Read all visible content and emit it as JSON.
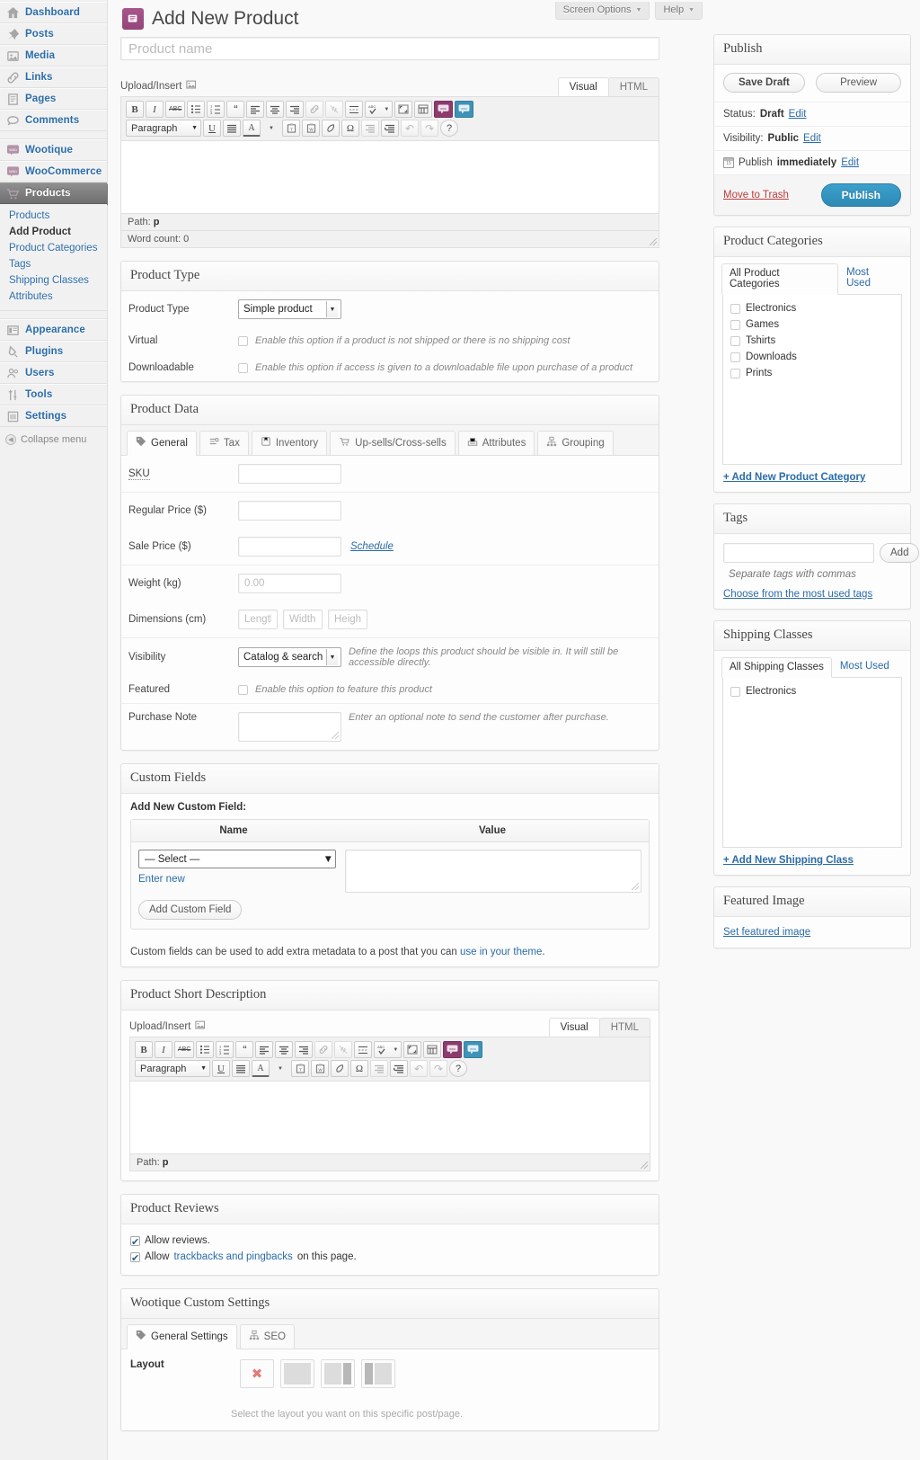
{
  "colors": {
    "accent_blue": "#2b6ca8",
    "publish_button": "#2d8ab5",
    "woo_purple": "#93467a",
    "trash_red": "#bc3c3c"
  },
  "sidebar": {
    "items": [
      {
        "label": "Dashboard",
        "icon": "dashboard-icon"
      },
      {
        "label": "Posts",
        "icon": "pin-icon"
      },
      {
        "label": "Media",
        "icon": "media-icon"
      },
      {
        "label": "Links",
        "icon": "link-icon"
      },
      {
        "label": "Pages",
        "icon": "pages-icon"
      },
      {
        "label": "Comments",
        "icon": "comment-icon"
      },
      {
        "label": "Wootique",
        "icon": "woo-icon"
      },
      {
        "label": "WooCommerce",
        "icon": "woo-icon"
      },
      {
        "label": "Products",
        "icon": "cart-icon"
      }
    ],
    "submenu": [
      {
        "label": "Products",
        "active": false
      },
      {
        "label": "Add Product",
        "active": true
      },
      {
        "label": "Product Categories",
        "active": false
      },
      {
        "label": "Tags",
        "active": false
      },
      {
        "label": "Shipping Classes",
        "active": false
      },
      {
        "label": "Attributes",
        "active": false
      }
    ],
    "items_bottom": [
      {
        "label": "Appearance",
        "icon": "appearance-icon"
      },
      {
        "label": "Plugins",
        "icon": "plugin-icon"
      },
      {
        "label": "Users",
        "icon": "users-icon"
      },
      {
        "label": "Tools",
        "icon": "tools-icon"
      },
      {
        "label": "Settings",
        "icon": "settings-icon"
      }
    ],
    "collapse_label": "Collapse menu"
  },
  "header": {
    "screen_options": "Screen Options",
    "help": "Help",
    "page_title": "Add New Product"
  },
  "title_field": {
    "placeholder": "Product name",
    "value": ""
  },
  "editor": {
    "upload_insert": "Upload/Insert",
    "tabs": [
      "Visual",
      "HTML"
    ],
    "active_tab": "Visual",
    "paragraph_select": "Paragraph",
    "path_label": "Path:",
    "path_value": "p",
    "word_count": "Word count: 0",
    "toolbar_row1": [
      {
        "glyph": "B",
        "name": "bold-icon"
      },
      {
        "glyph": "I",
        "name": "italic-icon"
      },
      {
        "glyph": "ABC",
        "name": "strikethrough-icon"
      },
      {
        "glyph": "",
        "name": "unordered-list-icon"
      },
      {
        "glyph": "",
        "name": "ordered-list-icon"
      },
      {
        "glyph": "“",
        "name": "blockquote-icon"
      },
      {
        "glyph": "",
        "name": "align-left-icon"
      },
      {
        "glyph": "",
        "name": "align-center-icon"
      },
      {
        "glyph": "",
        "name": "align-right-icon"
      },
      {
        "glyph": "",
        "name": "insert-link-icon"
      },
      {
        "glyph": "",
        "name": "unlink-icon"
      },
      {
        "glyph": "",
        "name": "more-tag-icon"
      },
      {
        "glyph": "ABC",
        "name": "spellcheck-icon"
      },
      {
        "glyph": "",
        "name": "fullscreen-icon"
      },
      {
        "glyph": "",
        "name": "kitchen-sink-icon"
      },
      {
        "glyph": "woo",
        "name": "woo-shortcode-icon"
      },
      {
        "glyph": "woo",
        "name": "woo-shortcode-alt-icon"
      }
    ],
    "toolbar_row2": [
      {
        "glyph": "U",
        "name": "underline-icon"
      },
      {
        "glyph": "",
        "name": "align-justify-icon"
      },
      {
        "glyph": "A",
        "name": "text-color-icon"
      },
      {
        "glyph": "",
        "name": "paste-text-icon"
      },
      {
        "glyph": "",
        "name": "paste-word-icon"
      },
      {
        "glyph": "",
        "name": "remove-formatting-icon"
      },
      {
        "glyph": "Ω",
        "name": "special-character-icon"
      },
      {
        "glyph": "",
        "name": "outdent-icon"
      },
      {
        "glyph": "",
        "name": "indent-icon"
      },
      {
        "glyph": "",
        "name": "undo-icon"
      },
      {
        "glyph": "",
        "name": "redo-icon"
      },
      {
        "glyph": "?",
        "name": "help-icon"
      }
    ]
  },
  "product_type_box": {
    "title": "Product Type",
    "rows": [
      {
        "label": "Product Type",
        "value": "Simple product"
      },
      {
        "label": "Virtual",
        "hint": "Enable this option if a product is not shipped or there is no shipping cost",
        "checked": false
      },
      {
        "label": "Downloadable",
        "hint": "Enable this option if access is given to a downloadable file upon purchase of a product",
        "checked": false
      }
    ]
  },
  "product_data": {
    "title": "Product Data",
    "tabs": [
      {
        "label": "General",
        "icon": "tag-icon",
        "active": true
      },
      {
        "label": "Tax",
        "icon": "tax-icon",
        "active": false
      },
      {
        "label": "Inventory",
        "icon": "inventory-icon",
        "active": false
      },
      {
        "label": "Up-sells/Cross-sells",
        "icon": "cart-icon",
        "active": false
      },
      {
        "label": "Attributes",
        "icon": "attributes-icon",
        "active": false
      },
      {
        "label": "Grouping",
        "icon": "grouping-icon",
        "active": false
      }
    ],
    "sku_label": "SKU",
    "sku_value": "",
    "regular_price_label": "Regular Price ($)",
    "regular_price_value": "",
    "sale_price_label": "Sale Price ($)",
    "sale_price_value": "",
    "schedule_link": "Schedule",
    "weight_label": "Weight (kg)",
    "weight_placeholder": "0.00",
    "dimensions_label": "Dimensions (cm)",
    "dim_length_placeholder": "Length",
    "dim_width_placeholder": "Width",
    "dim_height_placeholder": "Height",
    "visibility_label": "Visibility",
    "visibility_value": "Catalog & search",
    "visibility_hint": "Define the loops this product should be visible in. It will still be accessible directly.",
    "featured_label": "Featured",
    "featured_hint": "Enable this option to feature this product",
    "featured_checked": false,
    "purchase_note_label": "Purchase Note",
    "purchase_note_hint": "Enter an optional note to send the customer after purchase."
  },
  "custom_fields": {
    "title": "Custom Fields",
    "subtitle": "Add New Custom Field:",
    "col_name": "Name",
    "col_value": "Value",
    "select_value": "— Select —",
    "enter_new": "Enter new",
    "add_button": "Add Custom Field",
    "note_prefix": "Custom fields can be used to add extra metadata to a post that you can ",
    "note_link": "use in your theme",
    "note_suffix": "."
  },
  "short_description": {
    "title": "Product Short Description",
    "upload_insert": "Upload/Insert",
    "tabs": [
      "Visual",
      "HTML"
    ],
    "active_tab": "Visual",
    "paragraph_select": "Paragraph",
    "path_label": "Path:",
    "path_value": "p"
  },
  "reviews": {
    "title": "Product Reviews",
    "allow_reviews": "Allow reviews.",
    "allow_reviews_checked": true,
    "allow_trackbacks_prefix": "Allow ",
    "allow_trackbacks_link": "trackbacks and pingbacks",
    "allow_trackbacks_suffix": " on this page.",
    "allow_trackbacks_checked": true
  },
  "wootique": {
    "title": "Wootique Custom Settings",
    "tabs": [
      {
        "label": "General Settings",
        "icon": "tag-icon",
        "active": true
      },
      {
        "label": "SEO",
        "icon": "grouping-icon",
        "active": false
      }
    ],
    "layout_label": "Layout",
    "layout_hint": "Select the layout you want on this specific post/page.",
    "layout_options": [
      {
        "name": "layout-none",
        "type": "x",
        "selected": true
      },
      {
        "name": "layout-full-width",
        "type": "full",
        "selected": false
      },
      {
        "name": "layout-right-sidebar",
        "type": "right",
        "selected": false
      },
      {
        "name": "layout-left-sidebar",
        "type": "left",
        "selected": false
      }
    ]
  },
  "publish": {
    "title": "Publish",
    "save_draft": "Save Draft",
    "preview": "Preview",
    "status_label": "Status:",
    "status_value": "Draft",
    "status_edit": "Edit",
    "visibility_label": "Visibility:",
    "visibility_value": "Public",
    "visibility_edit": "Edit",
    "publish_prefix": "Publish",
    "publish_when": "immediately",
    "publish_edit": "Edit",
    "move_to_trash": "Move to Trash",
    "publish_button": "Publish"
  },
  "product_categories": {
    "title": "Product Categories",
    "tabs": [
      {
        "label": "All Product Categories",
        "active": true
      },
      {
        "label": "Most Used",
        "active": false
      }
    ],
    "items": [
      {
        "label": "Electronics",
        "checked": false
      },
      {
        "label": "Games",
        "checked": false
      },
      {
        "label": "Tshirts",
        "checked": false
      },
      {
        "label": "Downloads",
        "checked": false
      },
      {
        "label": "Prints",
        "checked": false
      }
    ],
    "add_link": "+ Add New Product Category"
  },
  "tags": {
    "title": "Tags",
    "input_value": "",
    "add_button": "Add",
    "hint": "Separate tags with commas",
    "link": "Choose from the most used tags"
  },
  "shipping_classes": {
    "title": "Shipping Classes",
    "tabs": [
      {
        "label": "All Shipping Classes",
        "active": true
      },
      {
        "label": "Most Used",
        "active": false
      }
    ],
    "items": [
      {
        "label": "Electronics",
        "checked": false
      }
    ],
    "add_link": "+ Add New Shipping Class"
  },
  "featured_image": {
    "title": "Featured Image",
    "link": "Set featured image"
  }
}
